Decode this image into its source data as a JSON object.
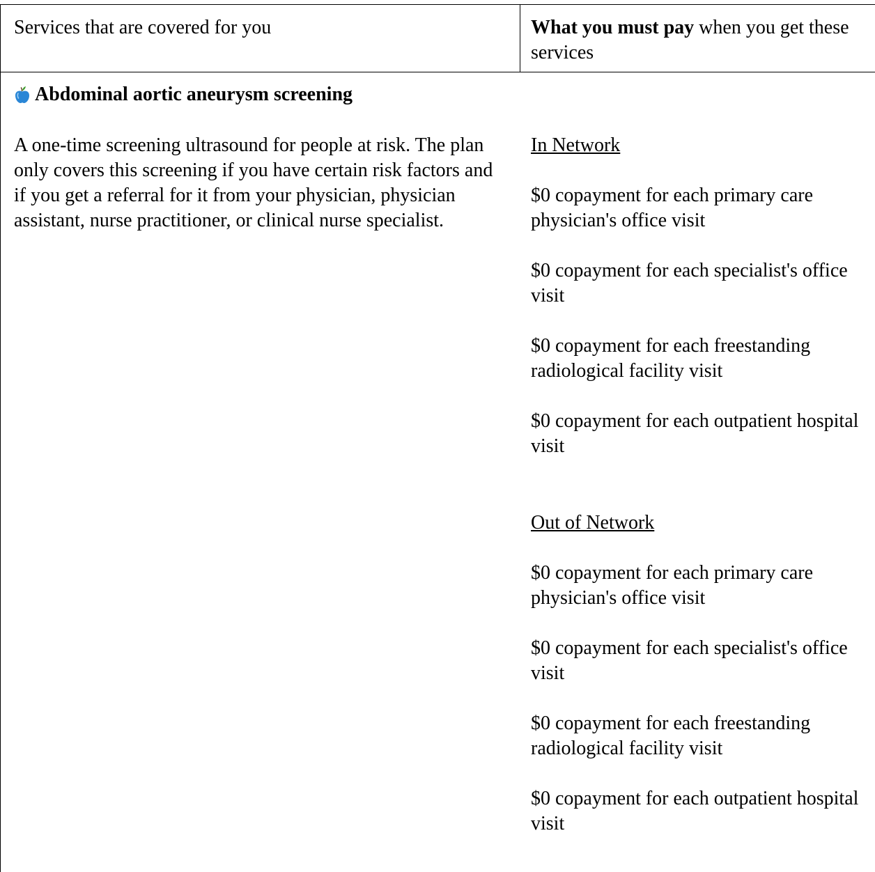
{
  "header": {
    "left": "Services that are covered for you",
    "right_bold": "What you must pay",
    "right_rest": " when you get these services"
  },
  "service": {
    "icon": "apple-icon",
    "title": "Abdominal aortic aneurysm screening",
    "description": "A one-time screening ultrasound for people at risk. The plan only covers this screening if you have certain risk factors and if you get a referral for it from your physician, physician assistant, nurse practitioner, or clinical nurse specialist."
  },
  "in_network": {
    "heading": "In Network",
    "items": [
      "$0 copayment for each primary care physician's office visit",
      "$0 copayment for each specialist's office visit",
      "$0 copayment for each freestanding radiological facility visit",
      "$0 copayment for each outpatient hospital visit"
    ]
  },
  "out_of_network": {
    "heading": "Out of Network",
    "items": [
      "$0 copayment for each primary care physician's office visit",
      "$0 copayment for each specialist's office visit",
      "$0 copayment for each freestanding radiological facility visit",
      "$0 copayment for each outpatient hospital visit"
    ]
  },
  "colors": {
    "apple_blue": "#2a86d6",
    "apple_leaf": "#3a9a2a"
  }
}
